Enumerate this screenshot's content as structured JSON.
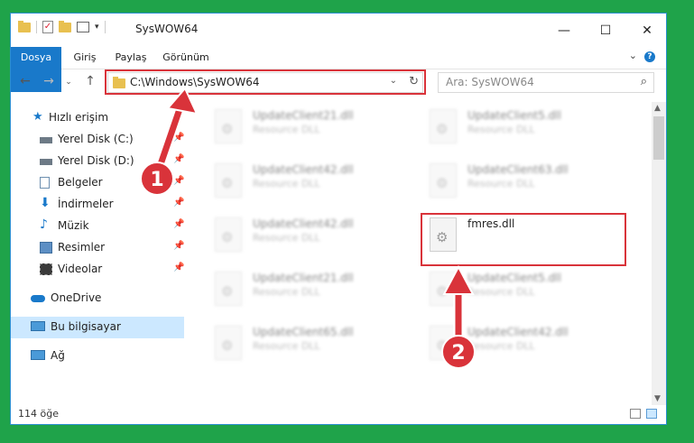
{
  "window": {
    "title": "SysWOW64"
  },
  "ribbon": {
    "tabs": [
      "Dosya",
      "Giriş",
      "Paylaş",
      "Görünüm"
    ]
  },
  "navigation": {
    "address": "C:\\Windows\\SysWOW64",
    "search_placeholder": "Ara: SysWOW64"
  },
  "sidebar": {
    "items": [
      {
        "label": "Hızlı erişim",
        "icon": "star-icon",
        "pinned": false
      },
      {
        "label": "Yerel Disk (C:)",
        "icon": "drive-icon",
        "pinned": true
      },
      {
        "label": "Yerel Disk (D:)",
        "icon": "drive-icon",
        "pinned": true
      },
      {
        "label": "Belgeler",
        "icon": "document-icon",
        "pinned": true
      },
      {
        "label": "İndirmeler",
        "icon": "download-icon",
        "pinned": true
      },
      {
        "label": "Müzik",
        "icon": "music-icon",
        "pinned": true
      },
      {
        "label": "Resimler",
        "icon": "picture-icon",
        "pinned": true
      },
      {
        "label": "Videolar",
        "icon": "video-icon",
        "pinned": true
      },
      {
        "label": "OneDrive",
        "icon": "cloud-icon",
        "pinned": false
      },
      {
        "label": "Bu bilgisayar",
        "icon": "computer-icon",
        "pinned": false,
        "selected": true
      },
      {
        "label": "Ağ",
        "icon": "network-icon",
        "pinned": false
      }
    ]
  },
  "files": [
    {
      "name": "UpdateClient21.dll",
      "type": "Resource DLL",
      "blurred": true
    },
    {
      "name": "UpdateClient5.dll",
      "type": "Resource DLL",
      "blurred": true
    },
    {
      "name": "UpdateClient42.dll",
      "type": "Resource DLL",
      "blurred": true
    },
    {
      "name": "UpdateClient63.dll",
      "type": "Resource DLL",
      "blurred": true
    },
    {
      "name": "UpdateClient42.dll",
      "type": "Resource DLL",
      "blurred": true
    },
    {
      "name": "fmres.dll",
      "type": "",
      "blurred": false
    },
    {
      "name": "UpdateClient21.dll",
      "type": "Resource DLL",
      "blurred": true
    },
    {
      "name": "UpdateClient5.dll",
      "type": "Resource DLL",
      "blurred": true
    },
    {
      "name": "UpdateClient65.dll",
      "type": "Resource DLL",
      "blurred": true
    },
    {
      "name": "UpdateClient42.dll",
      "type": "Resource DLL",
      "blurred": true
    }
  ],
  "status": {
    "count": "114 öğe"
  },
  "annotations": {
    "badge1": "1",
    "badge2": "2",
    "color": "#d9333a"
  }
}
